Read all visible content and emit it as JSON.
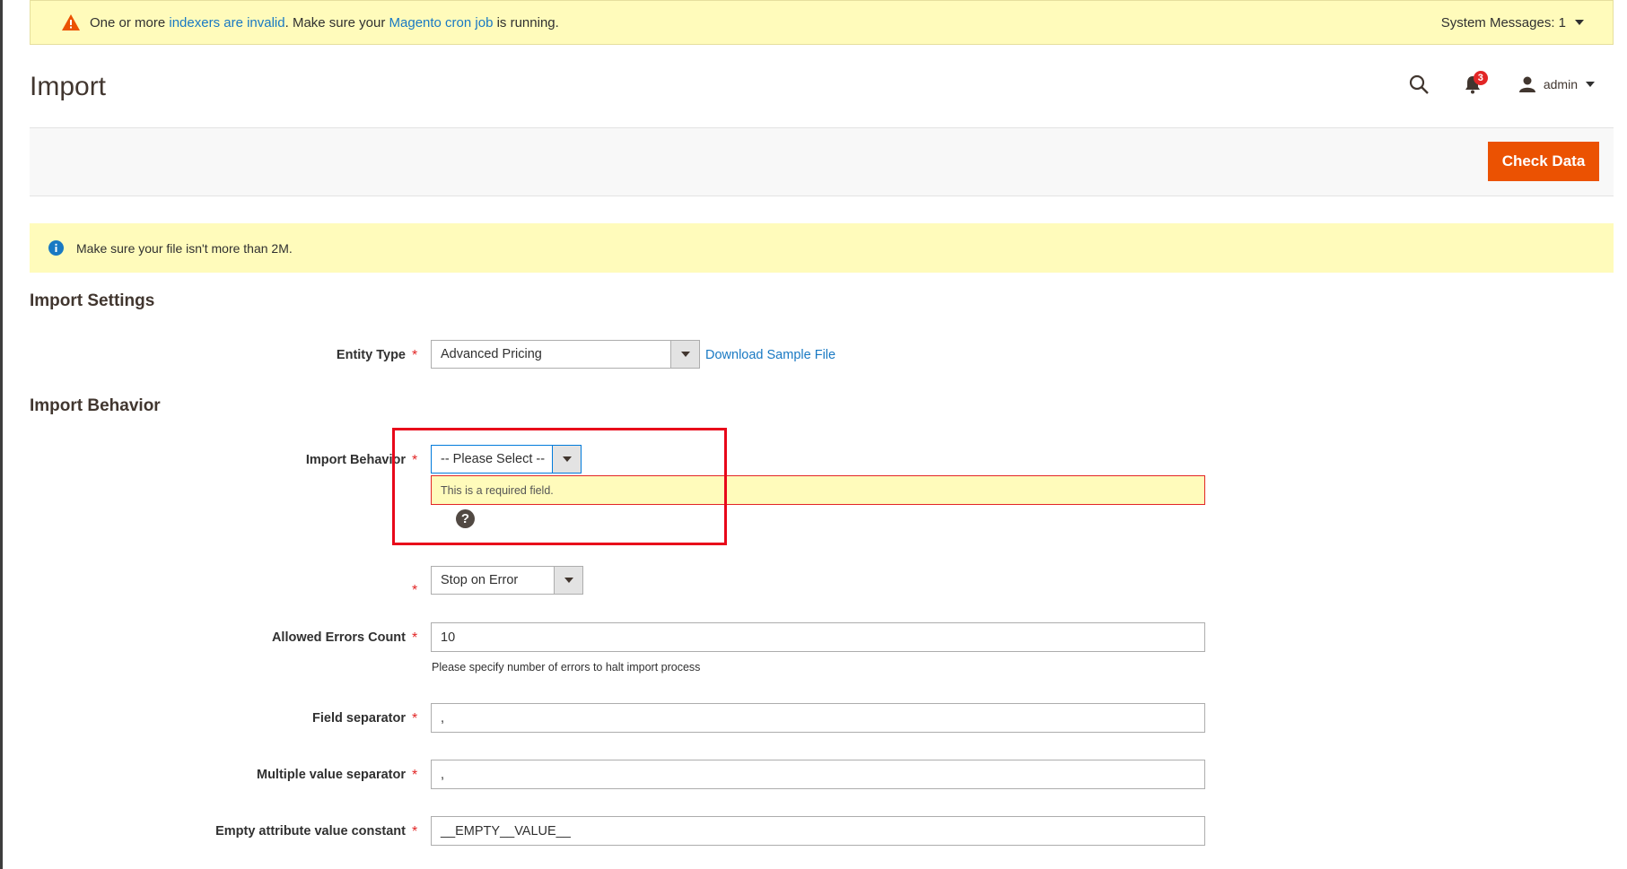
{
  "system_bar": {
    "pre": "One or more ",
    "link1": "indexers are invalid",
    "mid": ". Make sure your ",
    "link2": "Magento cron job",
    "post": " is running.",
    "system_messages": "System Messages: 1"
  },
  "header": {
    "title": "Import",
    "notifications_count": "3",
    "user": "admin"
  },
  "actions": {
    "check_data": "Check Data"
  },
  "notice": {
    "text": "Make sure your file isn't more than 2M."
  },
  "import_settings": {
    "title": "Import Settings",
    "entity_type_label": "Entity Type",
    "entity_type_value": "Advanced Pricing",
    "download_sample": "Download Sample File"
  },
  "import_behavior": {
    "title": "Import Behavior",
    "behavior_label": "Import Behavior",
    "behavior_value": "-- Please Select --",
    "error_text": "This is a required field.",
    "help": "?",
    "validation_value": "Stop on Error",
    "allowed_errors_label": "Allowed Errors Count",
    "allowed_errors_value": "10",
    "allowed_errors_note": "Please specify number of errors to halt import process",
    "field_sep_label": "Field separator",
    "field_sep_value": ",",
    "multi_sep_label": "Multiple value separator",
    "multi_sep_value": ",",
    "empty_const_label": "Empty attribute value constant",
    "empty_const_value": "__EMPTY__VALUE__"
  },
  "required_mark": "*",
  "colors": {
    "accent": "#eb5202",
    "link": "#1979c3",
    "required": "#e22626",
    "notice_bg": "#fffbbb",
    "highlight": "#e8081a"
  }
}
